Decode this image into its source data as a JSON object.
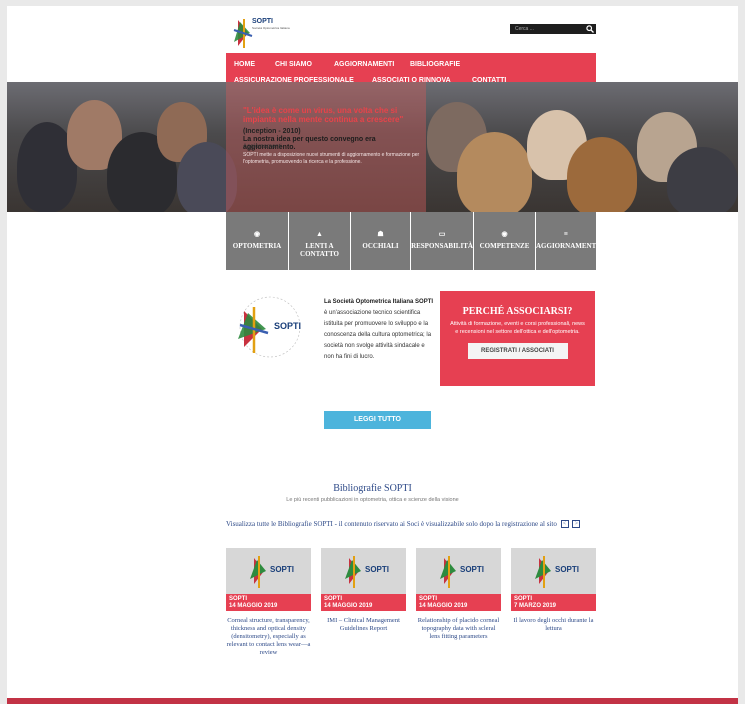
{
  "search": {
    "placeholder": "Cerca ..."
  },
  "logo": {
    "name": "SOPTI",
    "subtitle": "Società Optometrica Italiana"
  },
  "nav": {
    "items": [
      "HOME",
      "CHI SIAMO",
      "AGGIORNAMENTI",
      "BIBLIOGRAFIE",
      "ASSICURAZIONE PROFESSIONALE",
      "ASSOCIATI O RINNOVA",
      "CONTATTI"
    ]
  },
  "hero": {
    "quote": "\"L'idea è come un virus, una volta che si impianta nella mente continua a crescere\"",
    "year": "(Inception - 2010)",
    "title": "La nostra idea per questo convegno era aggiornamento.",
    "subtitle": "Aggiornamenti",
    "description": "SOPTI mette a disposizione nuovi strumenti di aggiornamento e formazione per l'optometria, promuovendo la ricerca e la professione."
  },
  "icon_bar": {
    "items": [
      {
        "glyph": "◉",
        "label": "OPTOMETRIA",
        "icon": "eye-icon"
      },
      {
        "glyph": "▲",
        "label": "LENTI A CONTATTO",
        "icon": "lens-icon"
      },
      {
        "glyph": "☗",
        "label": "OCCHIALI",
        "icon": "glasses-icon"
      },
      {
        "glyph": "▭",
        "label": "RESPONSABILITÀ",
        "icon": "card-icon"
      },
      {
        "glyph": "◉",
        "label": "COMPETENZE",
        "icon": "eye-icon"
      },
      {
        "glyph": "≡",
        "label": "AGGIORNAMENTI",
        "icon": "list-icon"
      }
    ]
  },
  "about": {
    "lead": "La Società Optometrica Italiana SOPTI",
    "body": "è un'associazione tecnico scientifica istituita per promuovere lo sviluppo e la conoscenza della cultura optometrica; la società non svolge attività sindacale e non ha fini di lucro.",
    "read_more": "LEGGI TUTTO",
    "logo_ring": "Società Optometrica Italiana"
  },
  "why": {
    "title": "PERCHÉ ASSOCIARSI?",
    "body": "Attività di formazione, eventi e corsi professionali, news e recensioni nel settore dell'ottica e dell'optometria.",
    "button": "REGISTRATI / ASSOCIATI"
  },
  "bibliografie": {
    "title": "Bibliografie SOPTI",
    "subtitle": "Le più recenti pubblicazioni in optometria, ottica e scienze della visione",
    "note": "Visualizza tutte le Bibliografie SOPTI - il contenuto riservato ai Soci è visualizzabile solo dopo la registrazione al sito",
    "prev": "<",
    "next": ">",
    "cards": [
      {
        "tag": "SOPTI",
        "date": "14 MAGGIO 2019",
        "title": "Corneal structure, transparency, thickness and optical density (densitometry), especially as relevant to contact lens wear—a review"
      },
      {
        "tag": "SOPTI",
        "date": "14 MAGGIO 2019",
        "title": "IMI – Clinical Management Guidelines Report"
      },
      {
        "tag": "SOPTI",
        "date": "14 MAGGIO 2019",
        "title": "Relationship of placido corneal topography data with scleral lens fitting parameters"
      },
      {
        "tag": "SOPTI",
        "date": "7 MARZO 2019",
        "title": "Il lavoro degli occhi durante la lettura"
      }
    ]
  },
  "colors": {
    "accent": "#e64052",
    "link": "#2e4a88",
    "button_blue": "#4db4dc",
    "icon_bar": "#7a7a7a"
  }
}
